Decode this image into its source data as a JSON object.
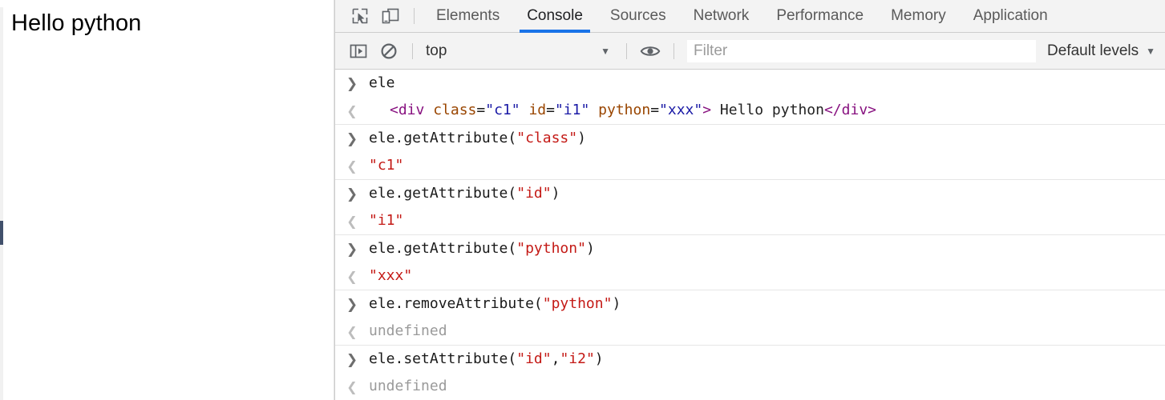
{
  "page": {
    "body_text": "Hello python",
    "scrollbar": "vertical-scrollbar"
  },
  "devtools": {
    "toolbar_icons": [
      {
        "name": "inspect-element-icon",
        "label": "Inspect element"
      },
      {
        "name": "device-toolbar-icon",
        "label": "Toggle device toolbar"
      }
    ],
    "tabs": [
      {
        "label": "Elements",
        "selected": false
      },
      {
        "label": "Console",
        "selected": true
      },
      {
        "label": "Sources",
        "selected": false
      },
      {
        "label": "Network",
        "selected": false
      },
      {
        "label": "Performance",
        "selected": false
      },
      {
        "label": "Memory",
        "selected": false
      },
      {
        "label": "Application",
        "selected": false
      }
    ],
    "filterbar": {
      "sidebar_icon": "console-sidebar-icon",
      "clear_icon": "clear-console-icon",
      "context": "top",
      "context_caret": "▼",
      "eye_icon": "live-expression-eye-icon",
      "filter_placeholder": "Filter",
      "filter_value": "",
      "levels": "Default levels",
      "levels_caret": "▼"
    },
    "prompts": {
      "input_arrow": "❯",
      "output_arrow": "❮"
    },
    "accent_color": "#1a73e8",
    "messages": [
      {
        "kind": "input",
        "parts": [
          {
            "type": "code",
            "text": "ele"
          }
        ]
      },
      {
        "kind": "output",
        "indent": true,
        "parts": [
          {
            "type": "tagname",
            "text": "<div"
          },
          {
            "type": "code",
            "text": " "
          },
          {
            "type": "attrname",
            "text": "class"
          },
          {
            "type": "code",
            "text": "="
          },
          {
            "type": "attrvalue",
            "text": "\"c1\""
          },
          {
            "type": "code",
            "text": " "
          },
          {
            "type": "attrname",
            "text": "id"
          },
          {
            "type": "code",
            "text": "="
          },
          {
            "type": "attrvalue",
            "text": "\"i1\""
          },
          {
            "type": "code",
            "text": " "
          },
          {
            "type": "attrname",
            "text": "python"
          },
          {
            "type": "code",
            "text": "="
          },
          {
            "type": "attrvalue",
            "text": "\"xxx\""
          },
          {
            "type": "tagname",
            "text": ">"
          },
          {
            "type": "text",
            "text": " Hello python"
          },
          {
            "type": "tagname",
            "text": "</div>"
          }
        ]
      },
      {
        "kind": "input",
        "parts": [
          {
            "type": "code",
            "text": "ele.getAttribute("
          },
          {
            "type": "str",
            "text": "\"class\""
          },
          {
            "type": "code",
            "text": ")"
          }
        ]
      },
      {
        "kind": "output",
        "parts": [
          {
            "type": "str",
            "text": "\"c1\""
          }
        ]
      },
      {
        "kind": "input",
        "parts": [
          {
            "type": "code",
            "text": "ele.getAttribute("
          },
          {
            "type": "str",
            "text": "\"id\""
          },
          {
            "type": "code",
            "text": ")"
          }
        ]
      },
      {
        "kind": "output",
        "parts": [
          {
            "type": "str",
            "text": "\"i1\""
          }
        ]
      },
      {
        "kind": "input",
        "parts": [
          {
            "type": "code",
            "text": "ele.getAttribute("
          },
          {
            "type": "str",
            "text": "\"python\""
          },
          {
            "type": "code",
            "text": ")"
          }
        ]
      },
      {
        "kind": "output",
        "parts": [
          {
            "type": "str",
            "text": "\"xxx\""
          }
        ]
      },
      {
        "kind": "input",
        "parts": [
          {
            "type": "code",
            "text": "ele.removeAttribute("
          },
          {
            "type": "str",
            "text": "\"python\""
          },
          {
            "type": "code",
            "text": ")"
          }
        ]
      },
      {
        "kind": "output",
        "parts": [
          {
            "type": "undef",
            "text": "undefined"
          }
        ]
      },
      {
        "kind": "input",
        "parts": [
          {
            "type": "code",
            "text": "ele.setAttribute("
          },
          {
            "type": "str",
            "text": "\"id\""
          },
          {
            "type": "code",
            "text": ","
          },
          {
            "type": "str",
            "text": "\"i2\""
          },
          {
            "type": "code",
            "text": ")"
          }
        ]
      },
      {
        "kind": "output",
        "parts": [
          {
            "type": "undef",
            "text": "undefined"
          }
        ]
      }
    ]
  }
}
